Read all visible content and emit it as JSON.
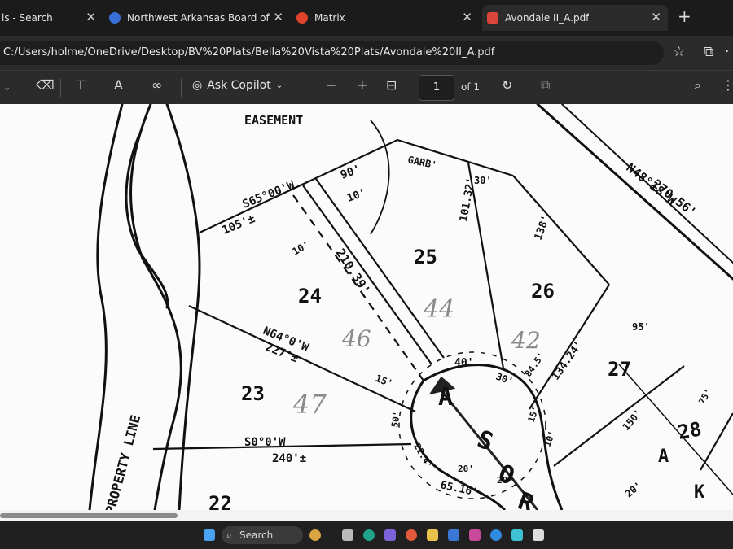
{
  "tabs": [
    {
      "label": "ls - Search",
      "active": false
    },
    {
      "label": "Northwest Arkansas Board of",
      "active": false
    },
    {
      "label": "Matrix",
      "active": false
    },
    {
      "label": "Avondale II_A.pdf",
      "active": true
    }
  ],
  "address": {
    "url": "C:/Users/holme/OneDrive/Desktop/BV%20Plats/Bella%20Vista%20Plats/Avondale%20II_A.pdf"
  },
  "toolbar": {
    "copilot_label": "Ask Copilot",
    "page_number": "1",
    "page_of": "of 1"
  },
  "taskbar": {
    "search_label": "Search"
  },
  "plat": {
    "easement": "EASEMENT",
    "line_labels": [
      "S65°00'W",
      "90'",
      "10'",
      "105'±",
      "10'",
      "210.39'",
      "GARB'",
      "30'",
      "101.32'",
      "138'",
      "270.56'",
      "N48°18'W",
      "N64°0'W",
      "227'±",
      "15'",
      "40'",
      "30'",
      "84.5'",
      "134.24'",
      "95'",
      "S0°0'W",
      "240'±",
      "15'",
      "10'",
      "150'",
      "20'",
      "65.16'",
      "50'",
      "22.4'",
      "20'",
      "75'",
      "20'"
    ],
    "lots": [
      "24",
      "25",
      "26",
      "27",
      "23",
      "28",
      "22"
    ],
    "handwritten": [
      "46",
      "44",
      "42",
      "47"
    ],
    "street": [
      "A",
      "S",
      "O",
      "R"
    ],
    "street_right": [
      "A",
      "K"
    ],
    "property_line": "PROPERTY LINE"
  },
  "colors": {
    "page": "#fbfbfb",
    "ink": "#111111",
    "pencil": "#8a8a8a",
    "chrome": "#2b2b2b"
  }
}
